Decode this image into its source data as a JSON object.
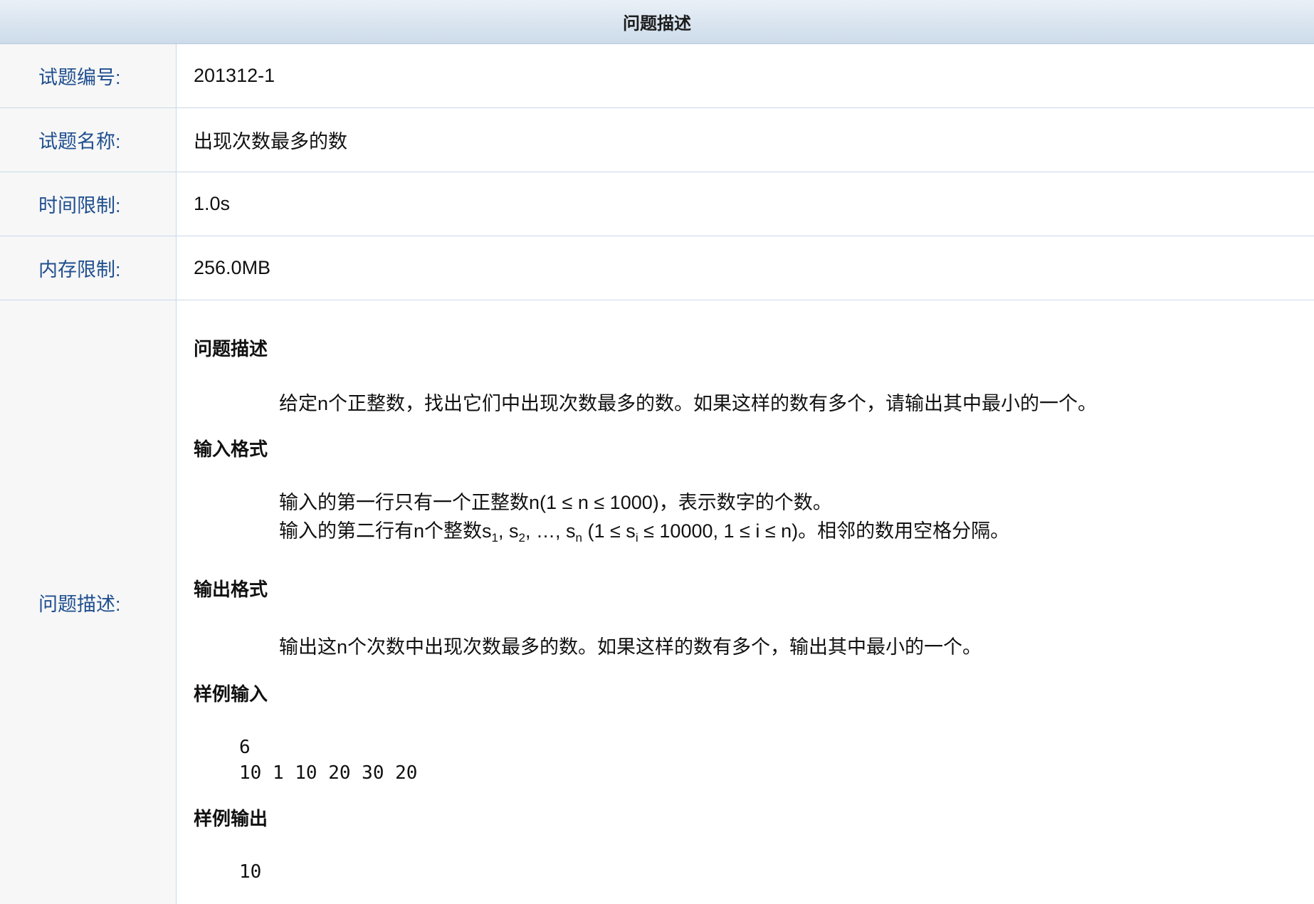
{
  "header": {
    "title": "问题描述"
  },
  "fields": [
    {
      "label": "试题编号:",
      "value": "201312-1"
    },
    {
      "label": "试题名称:",
      "value": "出现次数最多的数"
    },
    {
      "label": "时间限制:",
      "value": "1.0s"
    },
    {
      "label": "内存限制:",
      "value": "256.0MB"
    }
  ],
  "description": {
    "label": "问题描述:",
    "problem_title": "问题描述",
    "problem_text": "给定n个正整数，找出它们中出现次数最多的数。如果这样的数有多个，请输出其中最小的一个。",
    "input_title": "输入格式",
    "input_line1": "输入的第一行只有一个正整数n(1 ≤ n ≤ 1000)，表示数字的个数。",
    "input_line2": {
      "p1": "输入的第二行有n个整数s",
      "sub1": "1",
      "p2": ", s",
      "sub2": "2",
      "p3": ", …, s",
      "sub3": "n",
      "p4": " (1 ≤ s",
      "sub4": "i",
      "p5": " ≤ 10000, 1 ≤ i ≤ n)。相邻的数用空格分隔。"
    },
    "output_title": "输出格式",
    "output_text": "输出这n个次数中出现次数最多的数。如果这样的数有多个，输出其中最小的一个。",
    "sample_input_title": "样例输入",
    "sample_input_lines": [
      "6",
      "10 1 10 20 30 20"
    ],
    "sample_output_title": "样例输出",
    "sample_output_lines": [
      "10"
    ]
  }
}
